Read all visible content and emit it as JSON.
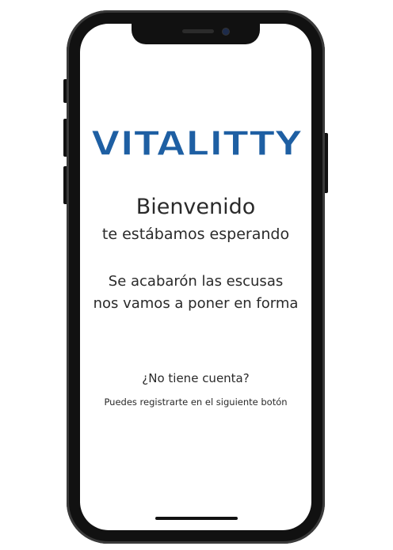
{
  "brand": {
    "logo_text": "VITALITTY",
    "color": "#1e5fa3"
  },
  "welcome": {
    "title": "Bienvenido",
    "subtitle": "te estábamos esperando"
  },
  "motto": {
    "line1": "Se acabarón las escusas",
    "line2": "nos vamos a poner en forma"
  },
  "signup": {
    "question": "¿No tiene cuenta?",
    "hint": "Puedes registrarte en el siguiente botón"
  }
}
